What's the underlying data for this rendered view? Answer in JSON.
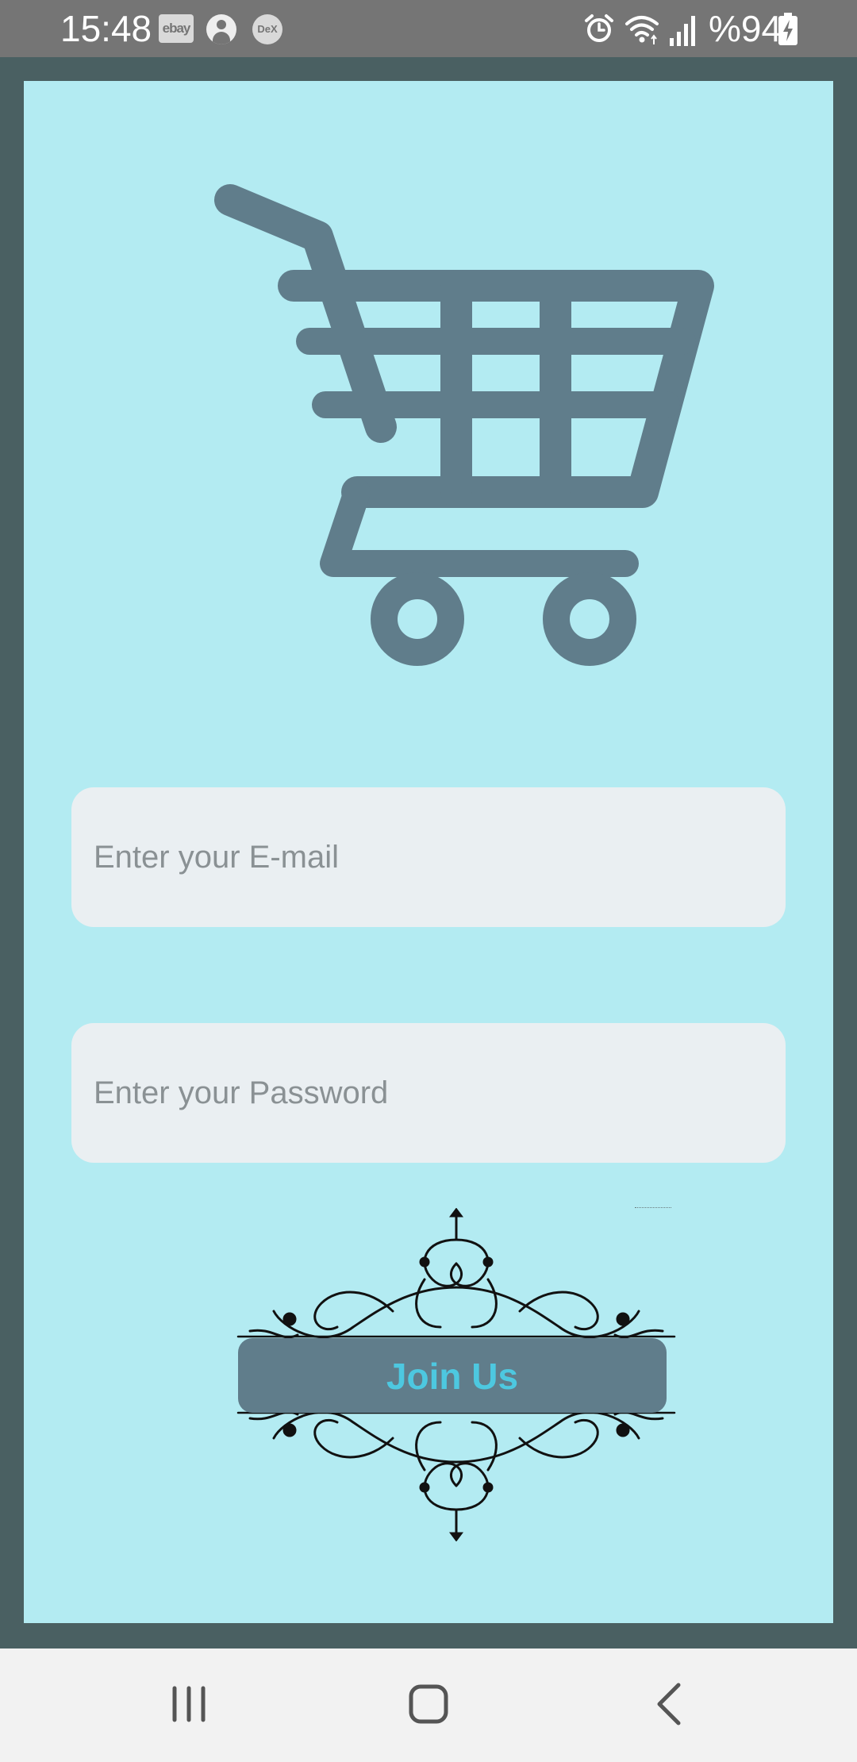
{
  "status_bar": {
    "time": "15:48",
    "ebay_icon_label": "ebay",
    "dex_icon_label": "DeX",
    "battery_text": "%94",
    "icons": [
      "ebay-icon",
      "account-icon",
      "dex-icon",
      "alarm-icon",
      "wifi-icon",
      "signal-icon",
      "battery-charging-icon"
    ]
  },
  "login": {
    "logo_icon": "shopping-cart-icon",
    "email_placeholder": "Enter your E-mail",
    "password_placeholder": "Enter your Password",
    "join_button_label": "Join Us"
  },
  "nav_bar": {
    "icons": [
      "recents-icon",
      "home-icon",
      "back-icon"
    ]
  },
  "colors": {
    "frame": "#4a6062",
    "panel": "#b3ebf2",
    "cart": "#607d8b",
    "field_bg": "#eaeff2",
    "placeholder": "#8a9194",
    "button_bg": "#607d8b",
    "button_text": "#4dc8e0"
  }
}
